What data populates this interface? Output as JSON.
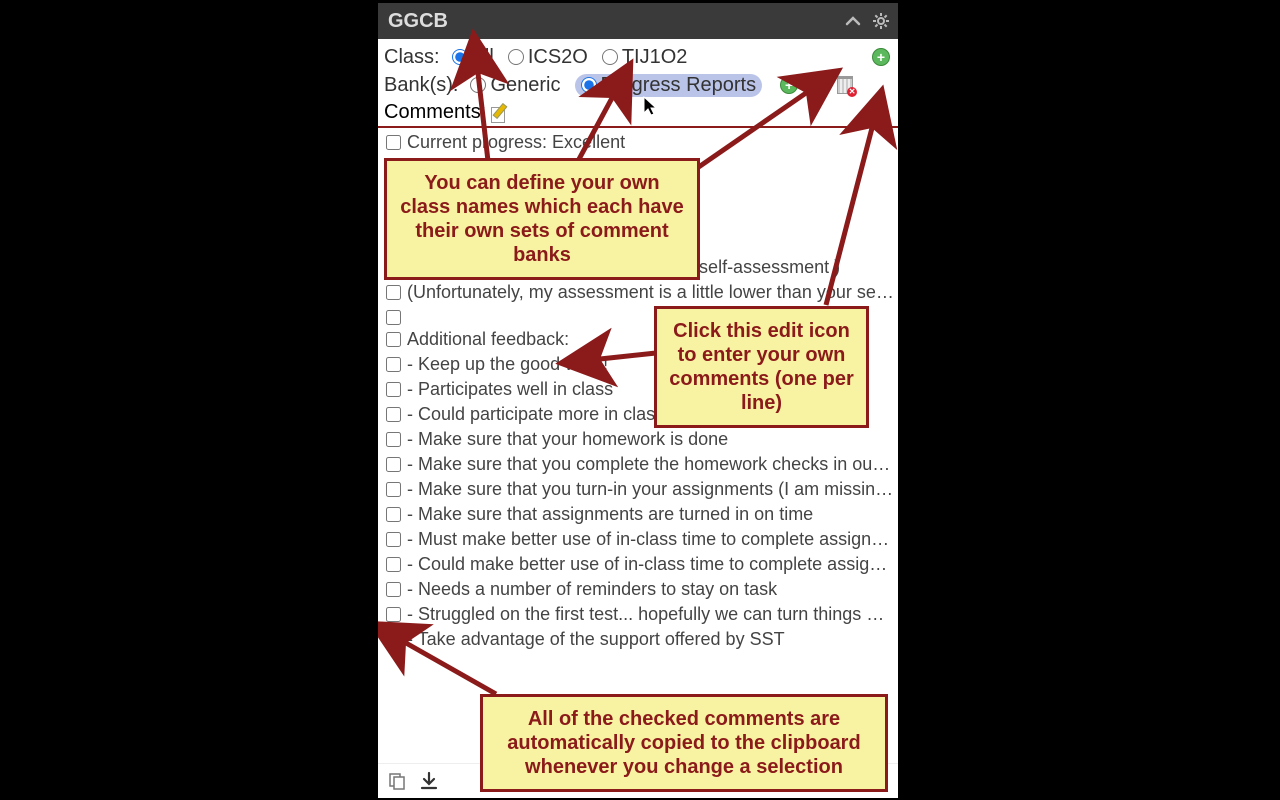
{
  "title": "GGCB",
  "labels": {
    "class": "Class:",
    "banks": "Bank(s):",
    "comments": "Comments:"
  },
  "classes": [
    {
      "label": "All",
      "selected": true
    },
    {
      "label": "ICS2O",
      "selected": false
    },
    {
      "label": "TIJ1O2",
      "selected": false
    }
  ],
  "banks": [
    {
      "label": "Generic",
      "selected": false
    },
    {
      "label": "Progress Reports",
      "selected": true
    }
  ],
  "comments": [
    "Current progress: Excellent",
    "(This matches with your self-assessment )",
    "(Unfortunately, my assessment is a little lower than your self…",
    "",
    "Additional feedback:",
    "- Keep up the good work!",
    "- Participates well in class",
    "- Could participate more in class",
    "- Make sure that your homework is done",
    "- Make sure that you complete the homework checks in our …",
    "- Make sure that you turn-in your assignments (I am missing …",
    "- Make sure that assignments are turned in on time",
    "- Must make better use of in-class time to complete assign…",
    "- Could make better use of in-class time to complete assign…",
    "- Needs a number of reminders to stay on task",
    "- Struggled on the first test... hopefully we can turn things ar…",
    "- Take advantage of the support offered by SST"
  ],
  "callouts": {
    "a": "You can define your own class names which each have their own sets of comment banks",
    "b": "Click this edit icon to enter your own comments (one per line)",
    "c": "All of the checked comments are automatically copied to the clipboard whenever you change a selection"
  }
}
